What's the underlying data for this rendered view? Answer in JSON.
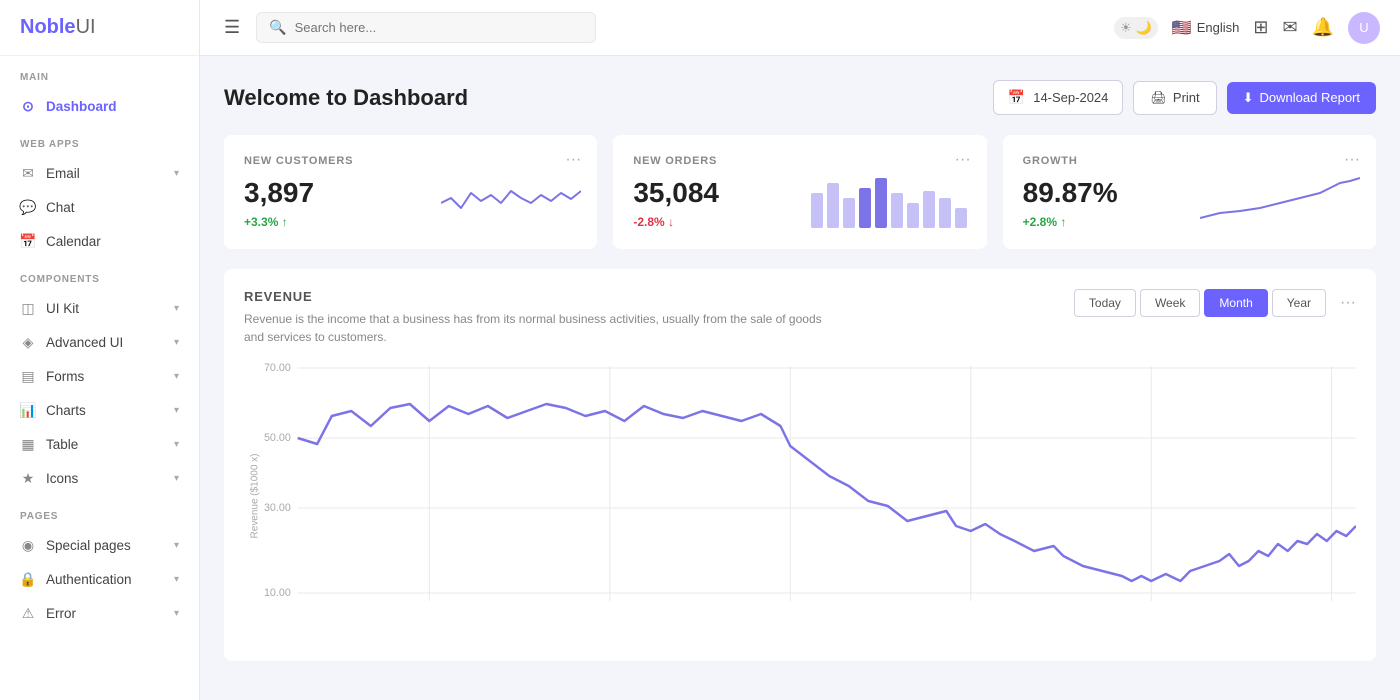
{
  "app": {
    "name_bold": "Noble",
    "name_light": "UI"
  },
  "topnav": {
    "hamburger_label": "☰",
    "search_placeholder": "Search here...",
    "language": "English",
    "theme_sun": "☀",
    "theme_moon": "🌙",
    "grid_icon": "⊞",
    "mail_icon": "✉",
    "bell_icon": "🔔"
  },
  "sidebar": {
    "sections": [
      {
        "label": "MAIN",
        "items": [
          {
            "id": "dashboard",
            "label": "Dashboard",
            "icon": "⊙",
            "active": true,
            "hasChevron": false
          }
        ]
      },
      {
        "label": "WEB APPS",
        "items": [
          {
            "id": "email",
            "label": "Email",
            "icon": "✉",
            "active": false,
            "hasChevron": true
          },
          {
            "id": "chat",
            "label": "Chat",
            "icon": "💬",
            "active": false,
            "hasChevron": false
          },
          {
            "id": "calendar",
            "label": "Calendar",
            "icon": "📅",
            "active": false,
            "hasChevron": false
          }
        ]
      },
      {
        "label": "COMPONENTS",
        "items": [
          {
            "id": "ui-kit",
            "label": "UI Kit",
            "icon": "◫",
            "active": false,
            "hasChevron": true
          },
          {
            "id": "advanced-ui",
            "label": "Advanced UI",
            "icon": "◈",
            "active": false,
            "hasChevron": true
          },
          {
            "id": "forms",
            "label": "Forms",
            "icon": "▤",
            "active": false,
            "hasChevron": true
          },
          {
            "id": "charts",
            "label": "Charts",
            "icon": "📊",
            "active": false,
            "hasChevron": true
          },
          {
            "id": "table",
            "label": "Table",
            "icon": "▦",
            "active": false,
            "hasChevron": true
          },
          {
            "id": "icons",
            "label": "Icons",
            "icon": "★",
            "active": false,
            "hasChevron": true
          }
        ]
      },
      {
        "label": "PAGES",
        "items": [
          {
            "id": "special-pages",
            "label": "Special pages",
            "icon": "◉",
            "active": false,
            "hasChevron": true
          },
          {
            "id": "authentication",
            "label": "Authentication",
            "icon": "🔒",
            "active": false,
            "hasChevron": true
          },
          {
            "id": "error",
            "label": "Error",
            "icon": "⚠",
            "active": false,
            "hasChevron": true
          }
        ]
      }
    ]
  },
  "dashboard": {
    "title": "Welcome to Dashboard",
    "date": "14-Sep-2024",
    "print_label": "Print",
    "download_label": "Download Report",
    "stats": [
      {
        "id": "new-customers",
        "label": "NEW CUSTOMERS",
        "value": "3,897",
        "change": "+3.3%",
        "change_type": "positive",
        "change_arrow": "↑"
      },
      {
        "id": "new-orders",
        "label": "NEW ORDERS",
        "value": "35,084",
        "change": "-2.8%",
        "change_type": "negative",
        "change_arrow": "↓"
      },
      {
        "id": "growth",
        "label": "GROWTH",
        "value": "89.87%",
        "change": "+2.8%",
        "change_type": "positive",
        "change_arrow": "↑"
      }
    ],
    "revenue": {
      "title": "REVENUE",
      "description": "Revenue is the income that a business has from its normal business activities, usually from the sale of goods and services to customers.",
      "tabs": [
        "Today",
        "Week",
        "Month",
        "Year"
      ],
      "active_tab": "Month",
      "y_axis_labels": [
        "70.00",
        "50.00",
        "30.00",
        "10.00"
      ],
      "y_axis_unit": "Revenue ($1000 x)"
    }
  }
}
